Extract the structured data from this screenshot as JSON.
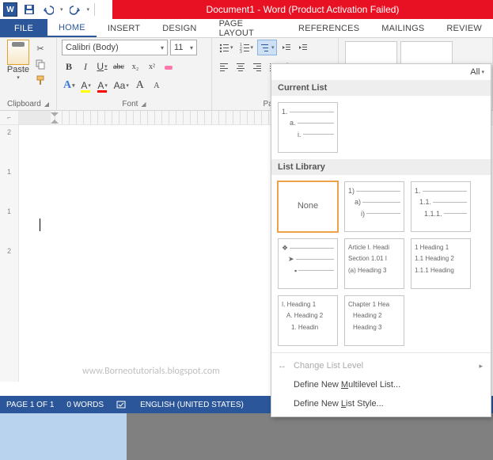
{
  "title": "Document1 - Word (Product Activation Failed)",
  "app_icon_text": "W",
  "tabs": {
    "file": "FILE",
    "home": "HOME",
    "insert": "INSERT",
    "design": "DESIGN",
    "page_layout": "PAGE LAYOUT",
    "references": "REFERENCES",
    "mailings": "MAILINGS",
    "review": "REVIEW"
  },
  "ribbon": {
    "clipboard": {
      "label": "Clipboard",
      "paste": "Paste"
    },
    "font": {
      "label": "Font",
      "name": "Calibri (Body)",
      "size": "11",
      "btn_bold": "B",
      "btn_italic": "I",
      "btn_underline": "U",
      "btn_strike": "abc",
      "btn_sub": "x₂",
      "btn_sup": "x²",
      "btn_case": "Aa",
      "btn_grow": "A",
      "btn_shrink": "A",
      "btn_hl": "A",
      "btn_color": "A"
    },
    "paragraph": {
      "label": "Paragr"
    }
  },
  "multilevel": {
    "all": "All",
    "current": "Current List",
    "library": "List Library",
    "none": "None",
    "tiles": {
      "num_alpha": {
        "l1": "1)",
        "l2": "a)",
        "l3": "i)"
      },
      "num_dot": {
        "l1": "1.",
        "l2": "1.1.",
        "l3": "1.1.1."
      },
      "article": {
        "l1": "Article I. Headi",
        "l2": "Section 1.01 I",
        "l3": "(a) Heading 3"
      },
      "heading_num": {
        "l1": "1 Heading 1",
        "l2": "1.1 Heading 2",
        "l3": "1.1.1 Heading"
      },
      "roman": {
        "l1": "I. Heading 1",
        "l2": "A. Heading 2",
        "l3": "1. Headin"
      },
      "chapter": {
        "l1": "Chapter 1 Hea",
        "l2": "Heading 2",
        "l3": "Heading 3"
      },
      "current_preview": {
        "l1": "1.",
        "l2": "a.",
        "l3": "i."
      }
    },
    "change_level": "Change List Level",
    "define_ml": "Define New Multilevel List...",
    "define_style": "Define New List Style..."
  },
  "status": {
    "page": "PAGE 1 OF 1",
    "words": "0 WORDS",
    "lang": "ENGLISH (UNITED STATES)"
  },
  "watermark": "www.Borneotutorials.blogspot.com",
  "ruler": {
    "marks": [
      "2",
      "1",
      "1",
      "2"
    ]
  }
}
